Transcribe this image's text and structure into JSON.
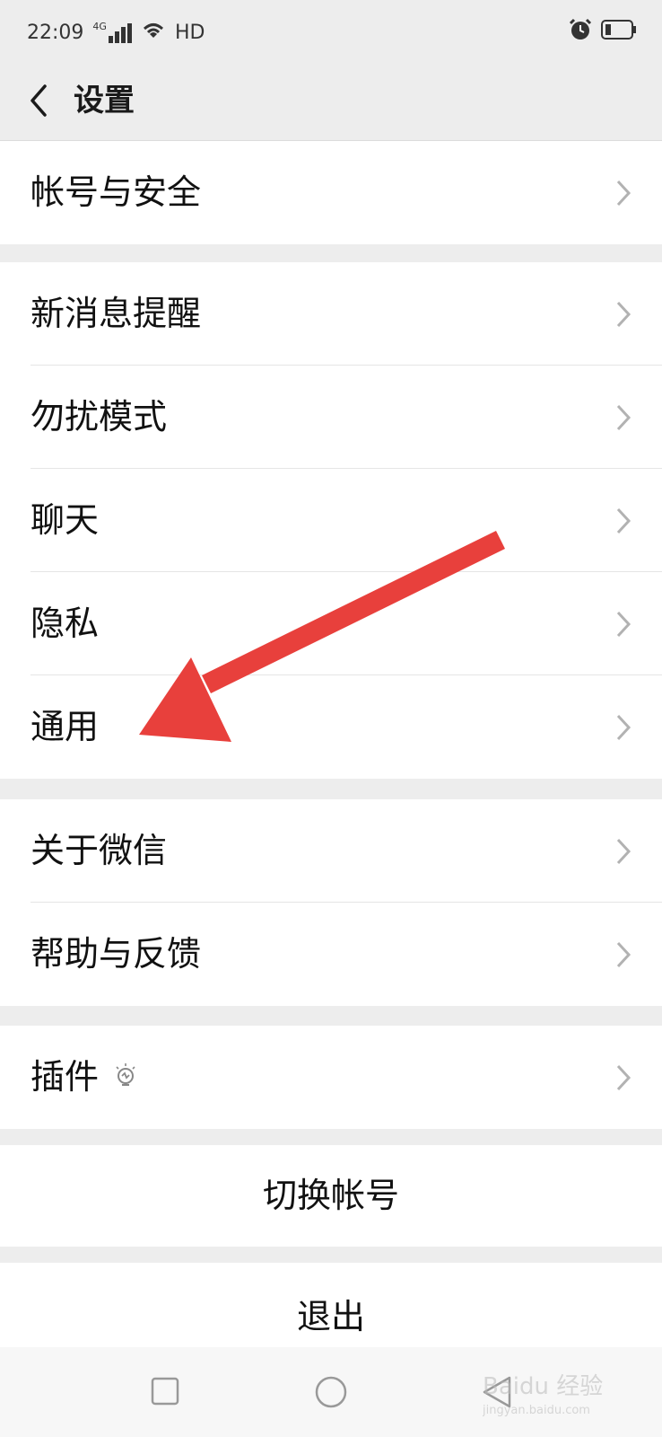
{
  "status_bar": {
    "time": "22:09",
    "network": "4G",
    "hd": "HD",
    "icons": [
      "signal-icon",
      "wifi-icon",
      "alarm-icon",
      "battery-icon"
    ]
  },
  "nav": {
    "title": "设置",
    "back_icon": "chevron-left-icon"
  },
  "sections": [
    {
      "items": [
        {
          "label": "帐号与安全"
        }
      ]
    },
    {
      "items": [
        {
          "label": "新消息提醒"
        },
        {
          "label": "勿扰模式"
        },
        {
          "label": "聊天"
        },
        {
          "label": "隐私"
        },
        {
          "label": "通用"
        }
      ]
    },
    {
      "items": [
        {
          "label": "关于微信"
        },
        {
          "label": "帮助与反馈"
        }
      ]
    },
    {
      "items": [
        {
          "label": "插件",
          "icon": "lightbulb-icon"
        }
      ]
    }
  ],
  "actions": {
    "switch_account": "切换帐号",
    "logout": "退出"
  },
  "watermark": {
    "text": "Baidu 经验",
    "sub": "jingyan.baidu.com"
  },
  "colors": {
    "background": "#ededed",
    "panel": "#ffffff",
    "arrow": "#e8403c"
  }
}
